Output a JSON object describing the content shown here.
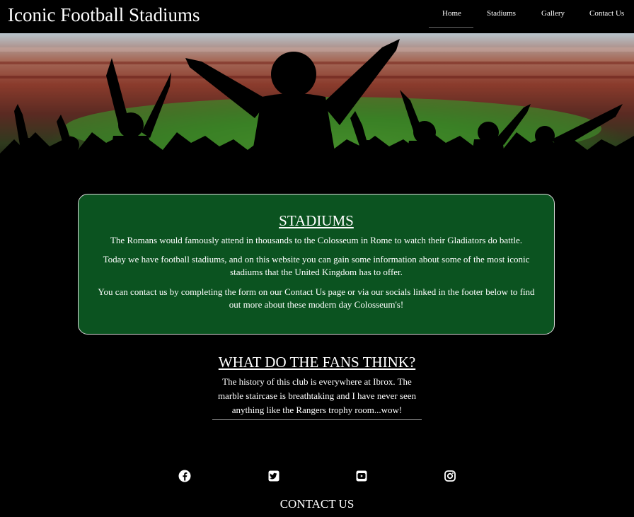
{
  "navbar": {
    "brand": "Iconic Football Stadiums",
    "links": [
      "Home",
      "Stadiums",
      "Gallery",
      "Contact Us"
    ],
    "active": "Home"
  },
  "hero": {
    "image": "crowd-silhouette-stadium"
  },
  "intro": {
    "title": "STADIUMS",
    "paragraphs": [
      "The Romans would famously attend in thousands to the Colosseum in Rome to watch their Gladiators do battle.",
      "Today we have football stadiums, and on this website you can gain some information about some of the most iconic stadiums that the United Kingdom has to offer.",
      "You can contact us by completing the form on our Contact Us page or via our socials linked in the footer below to find out more about these modern day Colosseum's!"
    ],
    "background_color": "#0b5320"
  },
  "fans": {
    "title": "WHAT DO THE FANS THINK?",
    "quote": "The history of this club is everywhere at Ibrox. The marble staircase is breathtaking and I have never seen anything like the Rangers trophy room...wow!"
  },
  "footer": {
    "socials": [
      "facebook-icon",
      "twitter-icon",
      "youtube-icon",
      "instagram-icon"
    ],
    "contact_heading": "CONTACT US"
  }
}
